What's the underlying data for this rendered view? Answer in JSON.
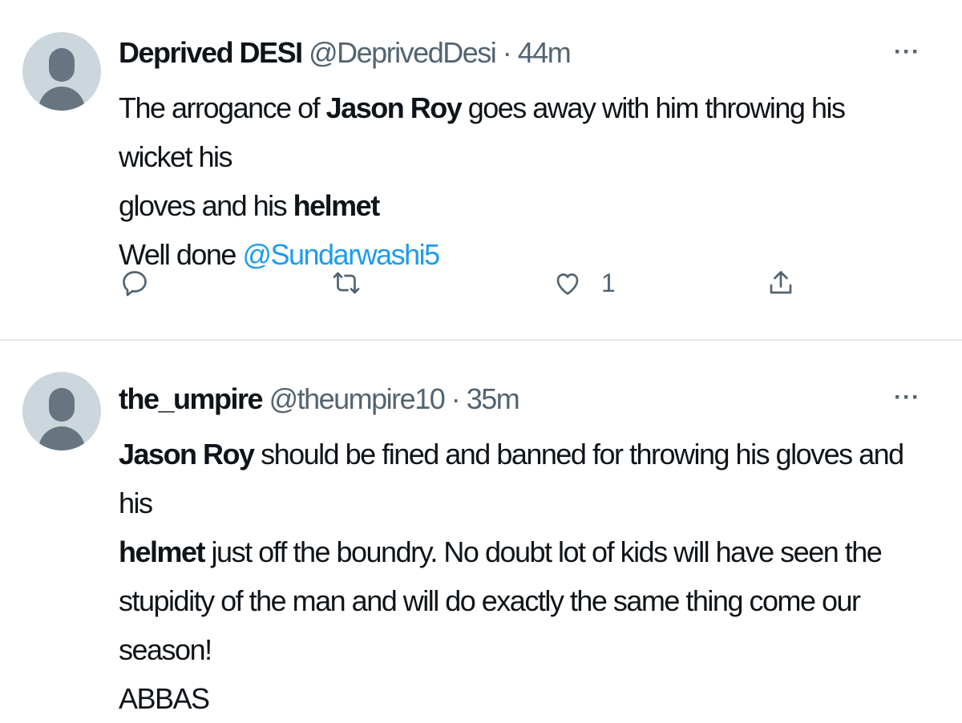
{
  "tweets": [
    {
      "display_name": "Deprived DESI",
      "handle": "@DeprivedDesi",
      "separator": " · ",
      "time": "44m",
      "more": "···",
      "lines": [
        [
          {
            "t": "The arrogance of "
          },
          {
            "t": "Jason Roy",
            "b": true
          },
          {
            "t": " goes away with him throwing his wicket his"
          }
        ],
        [
          {
            "t": "gloves and his "
          },
          {
            "t": "helmet",
            "b": true
          }
        ],
        [
          {
            "t": "Well done "
          },
          {
            "t": "@Sundarwashi5",
            "m": true
          }
        ]
      ],
      "actions": {
        "reply_icon": "reply-icon",
        "retweet_icon": "retweet-icon",
        "like_icon": "heart-icon",
        "like_count": "1",
        "share_icon": "share-icon"
      }
    },
    {
      "display_name": "the_umpire",
      "handle": "@theumpire10",
      "separator": " · ",
      "time": "35m",
      "more": "···",
      "lines": [
        [
          {
            "t": "Jason Roy",
            "b": true
          },
          {
            "t": " should be fined and banned for throwing his gloves and his"
          }
        ],
        [
          {
            "t": "helmet",
            "b": true
          },
          {
            "t": " just off the boundry. No doubt lot of kids will have seen the"
          }
        ],
        [
          {
            "t": "stupidity of the man and will do exactly the same thing come our season!"
          }
        ],
        [
          {
            "t": "ABBAS"
          }
        ]
      ]
    }
  ],
  "colors": {
    "text": "#0f1419",
    "secondary": "#536471",
    "link": "#1d9bf0",
    "avatar_bg": "#ccd6dd",
    "avatar_fg": "#66757f",
    "divider": "#e3e8ec"
  }
}
